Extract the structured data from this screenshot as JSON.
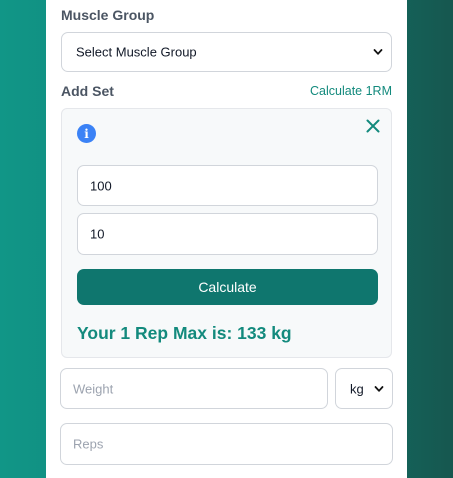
{
  "form": {
    "muscle_group_label": "Muscle Group",
    "muscle_group_select": "Select Muscle Group",
    "add_set_label": "Add Set",
    "calculate_link": "Calculate 1RM"
  },
  "calculator": {
    "info_icon": "info-icon",
    "close_icon": "close-icon",
    "weight_value": "100",
    "reps_value": "10",
    "calculate_button": "Calculate",
    "result_text": "Your 1 Rep Max is: 133 kg"
  },
  "set_inputs": {
    "weight_placeholder": "Weight",
    "unit_select": "kg",
    "reps_placeholder": "Reps"
  },
  "colors": {
    "accent": "#0f766e",
    "link": "#138a7d",
    "info": "#3b82f6"
  }
}
